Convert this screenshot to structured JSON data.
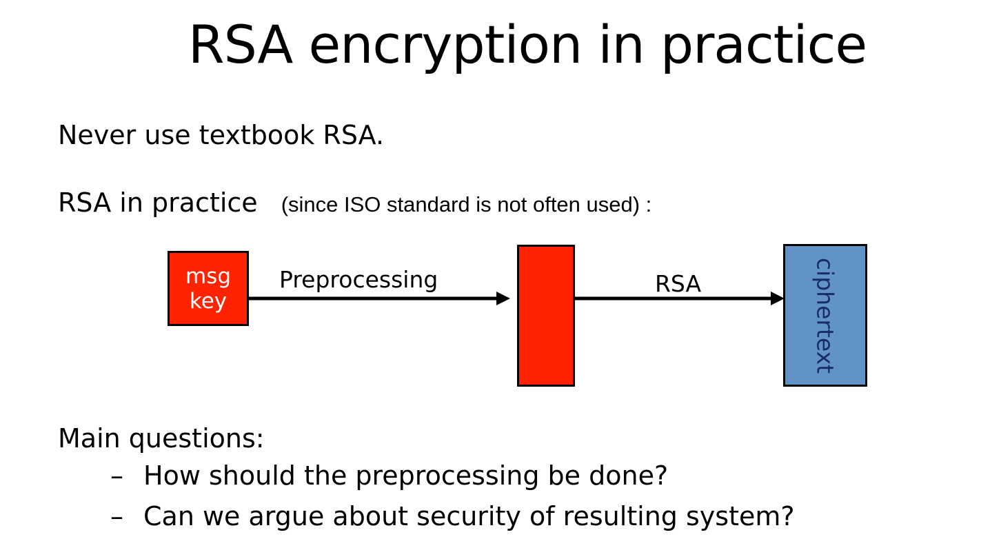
{
  "slide": {
    "title": "RSA encryption in practice",
    "line1": "Never use textbook RSA.",
    "line2_main": "RSA in practice",
    "line2_aside": "(since ISO standard is not often used) :",
    "questions_heading": "Main questions:",
    "bullet_dash": "–",
    "questions": [
      "How should the preprocessing be done?",
      "Can we argue about security of resulting system?"
    ]
  },
  "diagram": {
    "msg_label": "msg",
    "key_label": "key",
    "preprocessing_label": "Preprocessing",
    "rsa_label": "RSA",
    "ciphertext_label": "ciphertext",
    "colors": {
      "input_box": "#ff2300",
      "middle_box": "#ff2300",
      "ciphertext_box": "#6193c7",
      "ciphertext_text": "#1a2b6b"
    }
  }
}
